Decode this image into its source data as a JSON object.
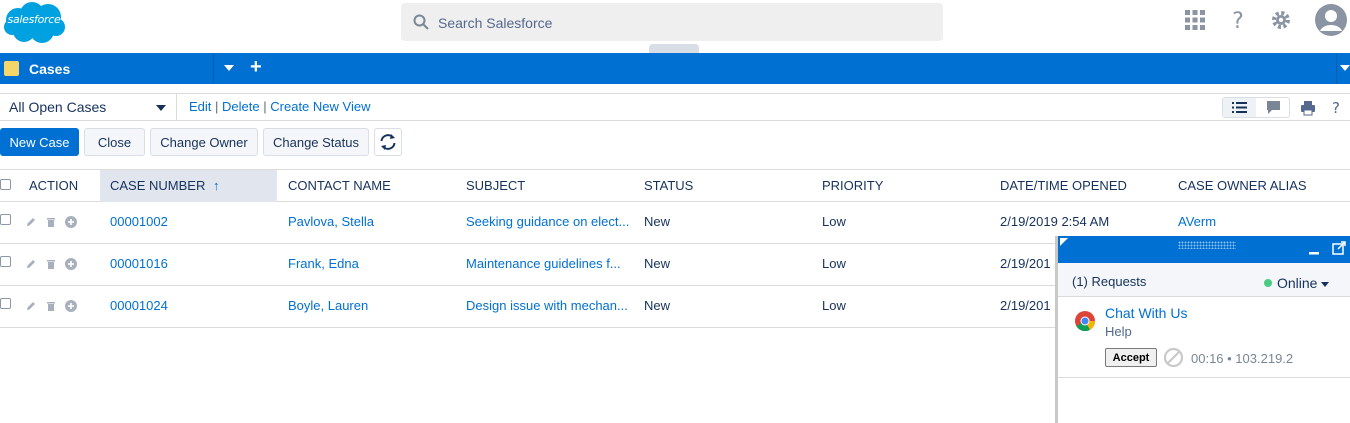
{
  "app": {
    "logo_text": "salesforce"
  },
  "search": {
    "placeholder": "Search Salesforce"
  },
  "nav": {
    "tab_label": "Cases"
  },
  "view": {
    "selected": "All Open Cases",
    "edit": "Edit",
    "delete": "Delete",
    "create": "Create New View",
    "sep": "|"
  },
  "buttons": {
    "new_case": "New Case",
    "close": "Close",
    "change_owner": "Change Owner",
    "change_status": "Change Status"
  },
  "table": {
    "columns": {
      "action": "ACTION",
      "case_number": "CASE NUMBER",
      "sort_arrow": "↑",
      "contact": "CONTACT NAME",
      "subject": "SUBJECT",
      "status": "STATUS",
      "priority": "PRIORITY",
      "opened": "DATE/TIME OPENED",
      "owner": "CASE OWNER ALIAS"
    },
    "rows": [
      {
        "case_number": "00001002",
        "contact": "Pavlova, Stella",
        "subject": "Seeking guidance on elect...",
        "status": "New",
        "priority": "Low",
        "opened": "2/19/2019 2:54 AM",
        "owner": "AVerm"
      },
      {
        "case_number": "00001016",
        "contact": "Frank, Edna",
        "subject": "Maintenance guidelines f...",
        "status": "New",
        "priority": "Low",
        "opened": "2/19/201",
        "owner": ""
      },
      {
        "case_number": "00001024",
        "contact": "Boyle, Lauren",
        "subject": "Design issue with mechan...",
        "status": "New",
        "priority": "Low",
        "opened": "2/19/201",
        "owner": ""
      }
    ]
  },
  "chat": {
    "requests": "(1) Requests",
    "status": "Online",
    "item_title": "Chat With Us",
    "item_subtitle": "Help",
    "accept": "Accept",
    "meta": "00:16 • 103.219.2"
  },
  "colors": {
    "brand": "#0070d2",
    "link": "#0070d2",
    "online": "#4bca81"
  }
}
